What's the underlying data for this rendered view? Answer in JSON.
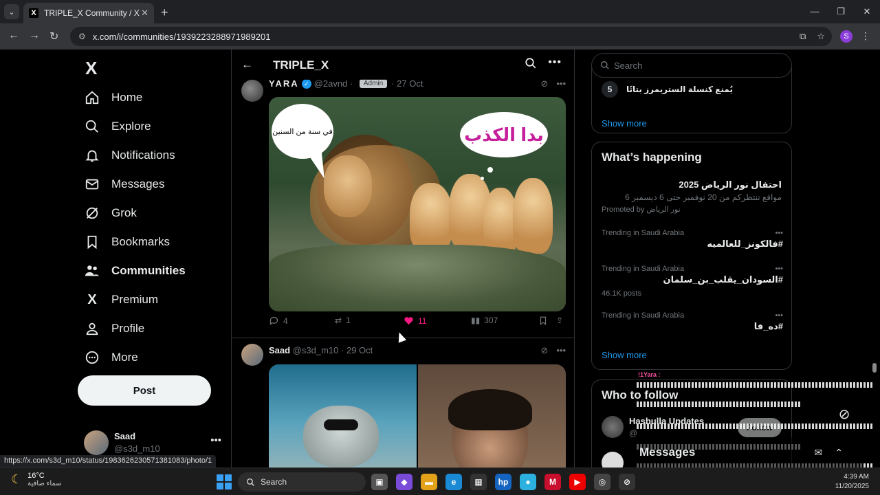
{
  "browser": {
    "tab_title": "TRIPLE_X Community / X",
    "url": "x.com/i/communities/1939223288971989201",
    "profile_initial": "S",
    "status_url": "https://x.com/s3d_m10/status/1983626230571381083/photo/1"
  },
  "nav": {
    "logo": "X",
    "items": [
      {
        "label": "Home",
        "icon": "home-icon"
      },
      {
        "label": "Explore",
        "icon": "search-icon"
      },
      {
        "label": "Notifications",
        "icon": "bell-icon"
      },
      {
        "label": "Messages",
        "icon": "mail-icon"
      },
      {
        "label": "Grok",
        "icon": "grok-icon"
      },
      {
        "label": "Bookmarks",
        "icon": "bookmark-icon"
      },
      {
        "label": "Communities",
        "icon": "people-icon"
      },
      {
        "label": "Premium",
        "icon": "x-icon"
      },
      {
        "label": "Profile",
        "icon": "person-icon"
      },
      {
        "label": "More",
        "icon": "more-circle-icon"
      }
    ],
    "post_button": "Post",
    "account": {
      "name": "Saad",
      "handle": "@s3d_m10"
    }
  },
  "header": {
    "title": "TRIPLE_X"
  },
  "tweet1": {
    "name": "YARA",
    "handle": "@2avnd",
    "badge": "Admin",
    "date": "27 Oct",
    "bubble_small": "في سنة من السنين",
    "bubble_big": "بدا الكذب",
    "replies": "4",
    "reposts": "1",
    "likes": "11",
    "views": "307"
  },
  "tweet2": {
    "name": "Saad",
    "handle": "@s3d_m10",
    "date": "29 Oct"
  },
  "right": {
    "search_placeholder": "Search",
    "rank": {
      "num": "5",
      "text": "يُمنع كنسلة الستريمرز بتاتًا"
    },
    "show_more": "Show more",
    "happening_title": "What’s happening",
    "promo": {
      "title": "احتفال نور الرياض 2025",
      "subtitle": "مواقع تنتظركم من 20 نوفمبر حتى 6 ديسمبر 6",
      "promoted_by": "Promoted by نور الرياض"
    },
    "trends": [
      {
        "meta": "Trending in Saudi Arabia",
        "tag": "#فالكونز_للعالميه",
        "posts": ""
      },
      {
        "meta": "Trending in Saudi Arabia",
        "tag": "#السودان_يقلب_بن_سلمان",
        "posts": "46.1K posts"
      },
      {
        "meta": "Trending in Saudi Arabia",
        "tag": "#ده_فا",
        "posts": ""
      }
    ],
    "show_more2": "Show more",
    "who_title": "Who to follow",
    "who": {
      "name": "Hasbulla Updates",
      "handle": "@",
      "follow": "Follow"
    }
  },
  "messages": {
    "title": "Messages"
  },
  "overlay": {
    "user": "!1Yara :"
  },
  "taskbar": {
    "temp": "16°C",
    "weather": "سماء صافية",
    "search": "Search",
    "time": "4:39 AM",
    "date": "11/20/2025"
  }
}
